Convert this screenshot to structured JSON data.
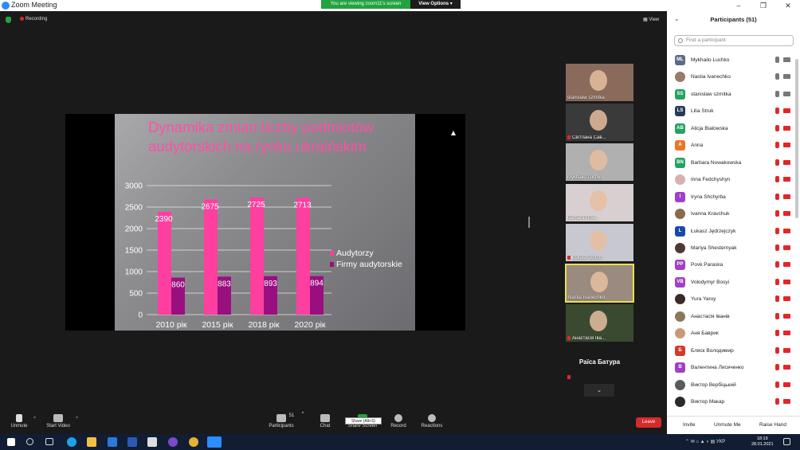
{
  "window": {
    "title": "Zoom Meeting"
  },
  "banner": {
    "viewing": "You are viewing zoom11's screen",
    "view_options": "View Options"
  },
  "status": {
    "recording": "Recording",
    "view": "View"
  },
  "slide": {
    "title": "Dynamika zmian liczby podmiotów audytorskich na rynku ukraińskim"
  },
  "chart_data": {
    "type": "bar",
    "categories": [
      "2010 рік",
      "2015 рік",
      "2018 рік",
      "2020 рік"
    ],
    "series": [
      {
        "name": "Audytorzy",
        "values": [
          2390,
          2675,
          2725,
          2713
        ],
        "color": "#ff3fa0"
      },
      {
        "name": "Firmy audytorskie",
        "values": [
          860,
          883,
          893,
          894
        ],
        "color": "#9a0f7f"
      }
    ],
    "yticks": [
      0,
      500,
      1000,
      1500,
      2000,
      2500,
      3000
    ],
    "ylim": [
      0,
      3000
    ],
    "legend": "right",
    "grid": true
  },
  "thumbnails": [
    {
      "name": "stanislaw szmitka",
      "muted": false,
      "bg": "#8a6a5a"
    },
    {
      "name": "Світлана Сав...",
      "muted": true,
      "bg": "#3a3a3a"
    },
    {
      "name": "Mykhailo Luchko",
      "muted": false,
      "bg": "#b0b0b0"
    },
    {
      "name": "Barbara Now...",
      "muted": false,
      "bg": "#d8d0d0"
    },
    {
      "name": "Łukasz Jędrz...",
      "muted": true,
      "bg": "#c8c8d0"
    },
    {
      "name": "Nastia Ivanechko",
      "muted": false,
      "bg": "#9a8a80",
      "active": true
    },
    {
      "name": "Анастасія Іва...",
      "muted": true,
      "bg": "#3a4a30"
    }
  ],
  "raisa": {
    "name": "Раїса Батура"
  },
  "toolbar": {
    "unmute": "Unmute",
    "start_video": "Start Video",
    "participants": "Participants",
    "participants_count": "51",
    "chat": "Chat",
    "share_screen": "Share Screen",
    "share_tip": "Share (Alt+S)",
    "record": "Record",
    "reactions": "Reactions",
    "leave": "Leave"
  },
  "panel": {
    "title": "Participants (51)",
    "search_placeholder": "Find a participant",
    "participants": [
      {
        "initials": "ML",
        "color": "#5b6c8a",
        "name": "Mykhailo Luchko",
        "state": "live"
      },
      {
        "initials": "",
        "color": "#9a7a6a",
        "name": "Nastia Ivanechko",
        "state": "live"
      },
      {
        "initials": "SS",
        "color": "#23a35f",
        "name": "stanislaw szmitka",
        "state": "live"
      },
      {
        "initials": "LS",
        "color": "#2a3a5a",
        "name": "Lilia Struk",
        "state": "muted"
      },
      {
        "initials": "AB",
        "color": "#23a35f",
        "name": "Alicja Bialowska",
        "state": "muted"
      },
      {
        "initials": "A",
        "color": "#e8772a",
        "name": "Anna",
        "state": "muted"
      },
      {
        "initials": "BN",
        "color": "#23a35f",
        "name": "Barbara Nowakowska",
        "state": "muted"
      },
      {
        "initials": "",
        "color": "#d8b0b0",
        "name": "Inna Fedchyshyn",
        "state": "muted"
      },
      {
        "initials": "I",
        "color": "#a23fc8",
        "name": "Iryna Shchyrba",
        "state": "muted"
      },
      {
        "initials": "",
        "color": "#8a6a4a",
        "name": "Ivanna Kravchuk",
        "state": "muted"
      },
      {
        "initials": "L",
        "color": "#1a4aa8",
        "name": "Łukasz Jędrzejczyk",
        "state": "muted"
      },
      {
        "initials": "",
        "color": "#4a3a30",
        "name": "Mariya Shesternyak",
        "state": "muted"
      },
      {
        "initials": "PP",
        "color": "#a23fc8",
        "name": "Povk Paraska",
        "state": "muted"
      },
      {
        "initials": "VB",
        "color": "#a23fc8",
        "name": "Volodymyr Bosyi",
        "state": "muted"
      },
      {
        "initials": "",
        "color": "#3a2a2a",
        "name": "Yura Yaruy",
        "state": "muted"
      },
      {
        "initials": "",
        "color": "#8a7a5a",
        "name": "Анастасія Іванів",
        "state": "muted"
      },
      {
        "initials": "",
        "color": "#c89a7a",
        "name": "Аня Баврик",
        "state": "muted"
      },
      {
        "initials": "Б",
        "color": "#d43a2a",
        "name": "Бляск Володимир",
        "state": "muted"
      },
      {
        "initials": "В",
        "color": "#a23fc8",
        "name": "Валентина Лисиченко",
        "state": "muted"
      },
      {
        "initials": "",
        "color": "#5a5a5a",
        "name": "Виктор Вербіцький",
        "state": "muted"
      },
      {
        "initials": "",
        "color": "#2a2a2a",
        "name": "Виктор Макар",
        "state": "muted"
      }
    ],
    "invite": "Invite",
    "unmute_me": "Unmute Me",
    "raise_hand": "Raise Hand"
  },
  "taskbar": {
    "time": "18:19",
    "date": "28.01.2021",
    "lang": "УКР"
  }
}
